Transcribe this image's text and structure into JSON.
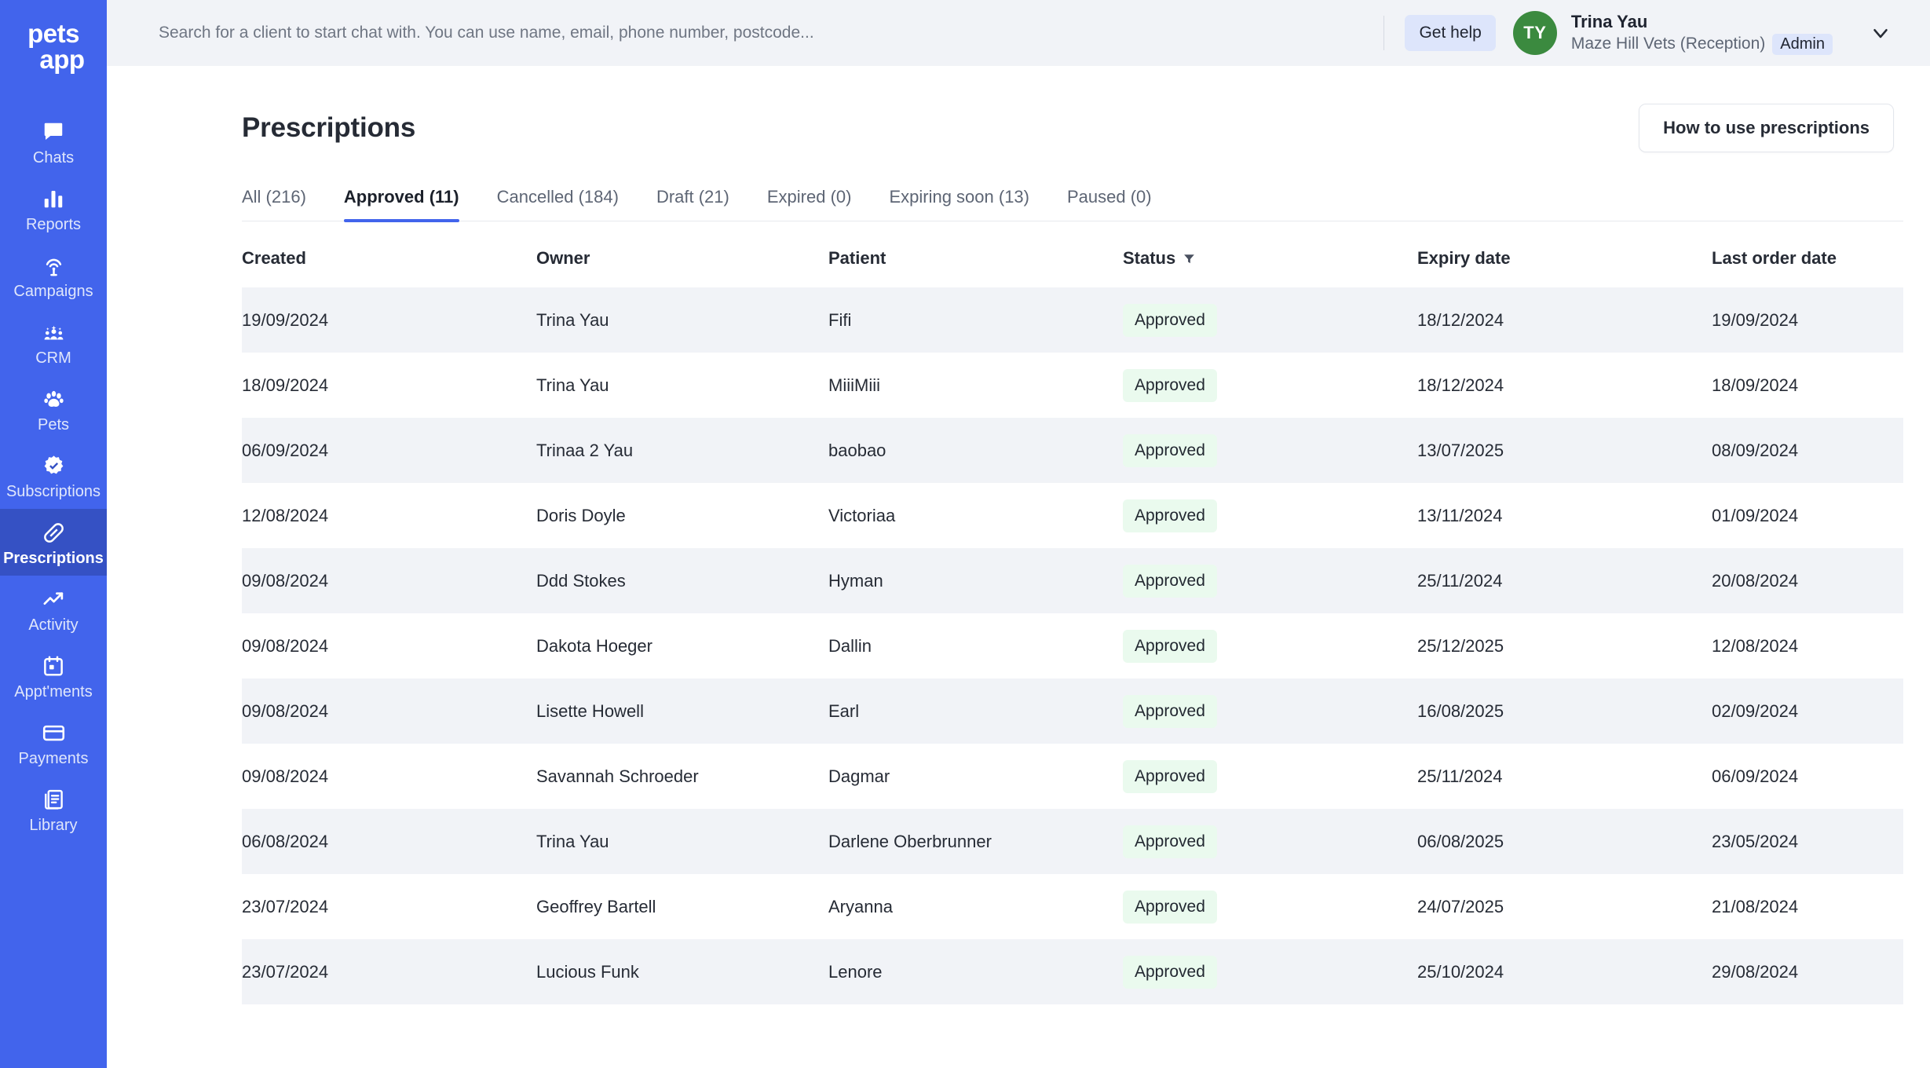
{
  "brand": {
    "line1": "pets",
    "line2": "app",
    "sidebar_color": "#4264ec",
    "active_color": "#3551c4"
  },
  "sidebar": {
    "items": [
      {
        "label": "Chats",
        "icon": "chat-icon",
        "active": false
      },
      {
        "label": "Reports",
        "icon": "bar-chart-icon",
        "active": false
      },
      {
        "label": "Campaigns",
        "icon": "broadcast-icon",
        "active": false
      },
      {
        "label": "CRM",
        "icon": "people-icon",
        "active": false
      },
      {
        "label": "Pets",
        "icon": "paw-icon",
        "active": false
      },
      {
        "label": "Subscriptions",
        "icon": "verified-badge-icon",
        "active": false
      },
      {
        "label": "Prescriptions",
        "icon": "pill-icon",
        "active": true
      },
      {
        "label": "Activity",
        "icon": "trending-up-icon",
        "active": false
      },
      {
        "label": "Appt'ments",
        "icon": "calendar-icon",
        "active": false
      },
      {
        "label": "Payments",
        "icon": "credit-card-icon",
        "active": false
      },
      {
        "label": "Library",
        "icon": "book-stack-icon",
        "active": false
      }
    ]
  },
  "topbar": {
    "search_placeholder": "Search for a client to start chat with. You can use name, email, phone number, postcode...",
    "search_value": "",
    "get_help_label": "Get help",
    "avatar_initials": "TY",
    "avatar_color": "#3b8a3f",
    "user_name": "Trina Yau",
    "user_org": "Maze Hill Vets (Reception)",
    "user_role": "Admin",
    "chevron_icon": "chevron-down-icon"
  },
  "page": {
    "title": "Prescriptions",
    "howto_button": "How to use prescriptions"
  },
  "tabs": [
    {
      "label": "All (216)",
      "active": false
    },
    {
      "label": "Approved (11)",
      "active": true
    },
    {
      "label": "Cancelled (184)",
      "active": false
    },
    {
      "label": "Draft (21)",
      "active": false
    },
    {
      "label": "Expired (0)",
      "active": false
    },
    {
      "label": "Expiring soon (13)",
      "active": false
    },
    {
      "label": "Paused (0)",
      "active": false
    }
  ],
  "table": {
    "columns": [
      {
        "key": "created",
        "label": "Created",
        "filter": false
      },
      {
        "key": "owner",
        "label": "Owner",
        "filter": false
      },
      {
        "key": "patient",
        "label": "Patient",
        "filter": false
      },
      {
        "key": "status",
        "label": "Status",
        "filter": true
      },
      {
        "key": "expiry",
        "label": "Expiry date",
        "filter": false
      },
      {
        "key": "last",
        "label": "Last order date",
        "filter": false
      }
    ],
    "status_badge_bg": "#eafaee",
    "rows": [
      {
        "created": "19/09/2024",
        "owner": "Trina Yau",
        "patient": "Fifi",
        "status": "Approved",
        "expiry": "18/12/2024",
        "last": "19/09/2024"
      },
      {
        "created": "18/09/2024",
        "owner": "Trina Yau",
        "patient": "MiiiMiii",
        "status": "Approved",
        "expiry": "18/12/2024",
        "last": "18/09/2024"
      },
      {
        "created": "06/09/2024",
        "owner": "Trinaa 2 Yau",
        "patient": "baobao",
        "status": "Approved",
        "expiry": "13/07/2025",
        "last": "08/09/2024"
      },
      {
        "created": "12/08/2024",
        "owner": "Doris Doyle",
        "patient": "Victoriaa",
        "status": "Approved",
        "expiry": "13/11/2024",
        "last": "01/09/2024"
      },
      {
        "created": "09/08/2024",
        "owner": "Ddd Stokes",
        "patient": "Hyman",
        "status": "Approved",
        "expiry": "25/11/2024",
        "last": "20/08/2024"
      },
      {
        "created": "09/08/2024",
        "owner": "Dakota Hoeger",
        "patient": "Dallin",
        "status": "Approved",
        "expiry": "25/12/2025",
        "last": "12/08/2024"
      },
      {
        "created": "09/08/2024",
        "owner": "Lisette Howell",
        "patient": "Earl",
        "status": "Approved",
        "expiry": "16/08/2025",
        "last": "02/09/2024"
      },
      {
        "created": "09/08/2024",
        "owner": "Savannah Schroeder",
        "patient": "Dagmar",
        "status": "Approved",
        "expiry": "25/11/2024",
        "last": "06/09/2024"
      },
      {
        "created": "06/08/2024",
        "owner": "Trina Yau",
        "patient": "Darlene Oberbrunner",
        "status": "Approved",
        "expiry": "06/08/2025",
        "last": "23/05/2024"
      },
      {
        "created": "23/07/2024",
        "owner": "Geoffrey Bartell",
        "patient": "Aryanna",
        "status": "Approved",
        "expiry": "24/07/2025",
        "last": "21/08/2024"
      },
      {
        "created": "23/07/2024",
        "owner": "Lucious Funk",
        "patient": "Lenore",
        "status": "Approved",
        "expiry": "25/10/2024",
        "last": "29/08/2024"
      }
    ]
  }
}
